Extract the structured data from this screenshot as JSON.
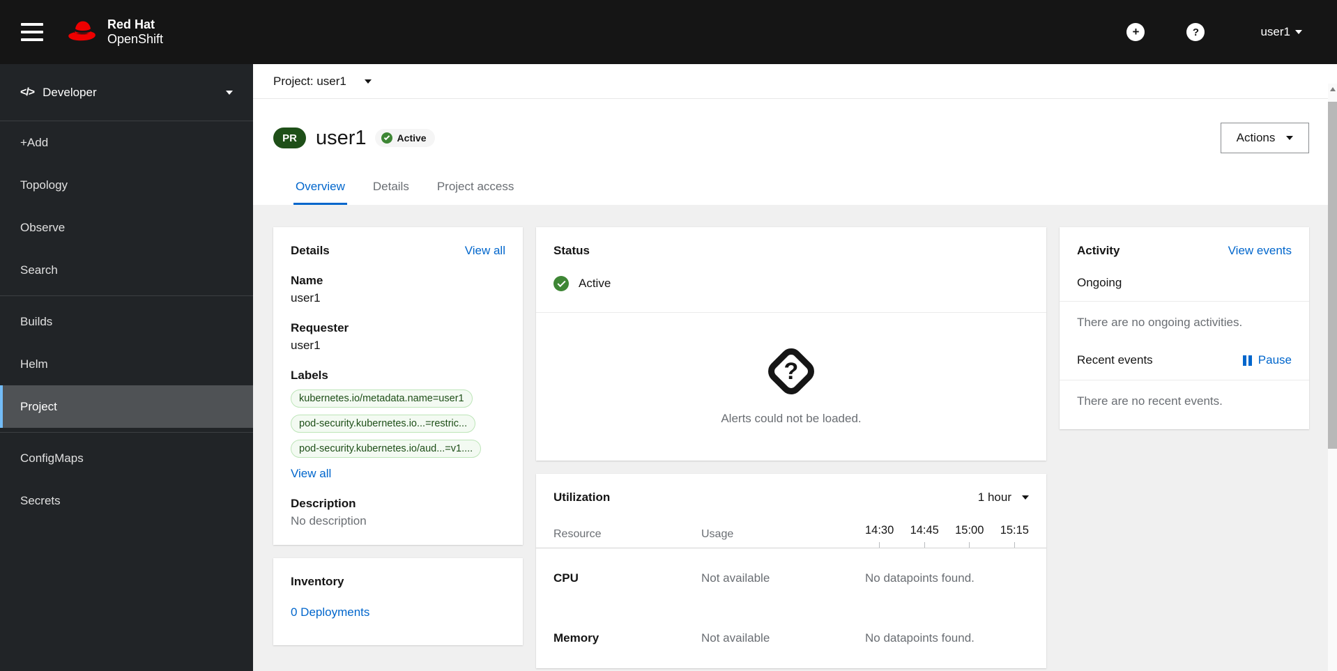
{
  "masthead": {
    "brand_line1": "Red Hat",
    "brand_line2": "OpenShift",
    "plus_glyph": "+",
    "help_glyph": "?",
    "username": "user1"
  },
  "sidebar": {
    "perspective": "Developer",
    "code_icon_glyph": "</>",
    "items": [
      {
        "label": "+Add"
      },
      {
        "label": "Topology"
      },
      {
        "label": "Observe"
      },
      {
        "label": "Search"
      },
      {
        "label": "Builds"
      },
      {
        "label": "Helm"
      },
      {
        "label": "Project"
      },
      {
        "label": "ConfigMaps"
      },
      {
        "label": "Secrets"
      }
    ],
    "selected": "Project"
  },
  "project_bar": {
    "label": "Project: user1"
  },
  "page_header": {
    "badge": "PR",
    "title": "user1",
    "status": "Active",
    "actions_label": "Actions"
  },
  "tabs": [
    {
      "label": "Overview"
    },
    {
      "label": "Details"
    },
    {
      "label": "Project access"
    }
  ],
  "details_card": {
    "title": "Details",
    "view_all": "View all",
    "name_label": "Name",
    "name_value": "user1",
    "requester_label": "Requester",
    "requester_value": "user1",
    "labels_label": "Labels",
    "labels": [
      "kubernetes.io/metadata.name=user1",
      "pod-security.kubernetes.io...=restric...",
      "pod-security.kubernetes.io/aud...=v1...."
    ],
    "labels_view_all": "View all",
    "description_label": "Description",
    "description_value": "No description"
  },
  "status_card": {
    "title": "Status",
    "status": "Active",
    "alerts_message": "Alerts could not be loaded.",
    "unknown_glyph": "?"
  },
  "utilization_card": {
    "title": "Utilization",
    "duration": "1 hour",
    "col_resource": "Resource",
    "col_usage": "Usage",
    "times": [
      "14:30",
      "14:45",
      "15:00",
      "15:15"
    ],
    "rows": [
      {
        "resource": "CPU",
        "usage": "Not available",
        "datapoints": "No datapoints found."
      },
      {
        "resource": "Memory",
        "usage": "Not available",
        "datapoints": "No datapoints found."
      }
    ]
  },
  "activity_card": {
    "title": "Activity",
    "view_events": "View events",
    "ongoing_label": "Ongoing",
    "ongoing_empty": "There are no ongoing activities.",
    "recent_label": "Recent events",
    "pause_label": "Pause",
    "recent_empty": "There are no recent events."
  },
  "inventory_card": {
    "title": "Inventory",
    "deployments_link": "0 Deployments"
  },
  "colors": {
    "accent_link": "#0066cc",
    "masthead_bg": "#151515",
    "sidebar_bg": "#212427",
    "selected_indicator": "#73bcf7",
    "success_green": "#3e8635",
    "project_badge_green": "#1e4f18",
    "label_pill_bg": "#f3faf2",
    "label_pill_border": "#bde5b8",
    "content_bg": "#f0f0f0"
  }
}
